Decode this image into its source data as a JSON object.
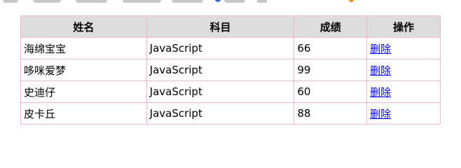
{
  "table": {
    "headers": [
      "姓名",
      "科目",
      "成绩",
      "操作"
    ],
    "rows": [
      {
        "name": "海绵宝宝",
        "subject": "JavaScript",
        "score": "66",
        "action": "删除"
      },
      {
        "name": "哆咪爱梦",
        "subject": "JavaScript",
        "score": "99",
        "action": "删除"
      },
      {
        "name": "史迪仔",
        "subject": "JavaScript",
        "score": "60",
        "action": "删除"
      },
      {
        "name": "皮卡丘",
        "subject": "JavaScript",
        "score": "88",
        "action": "删除"
      }
    ]
  },
  "colors": {
    "border": "#f4b6c8",
    "header_bg": "#dcdcdc",
    "link": "#0000ee"
  }
}
